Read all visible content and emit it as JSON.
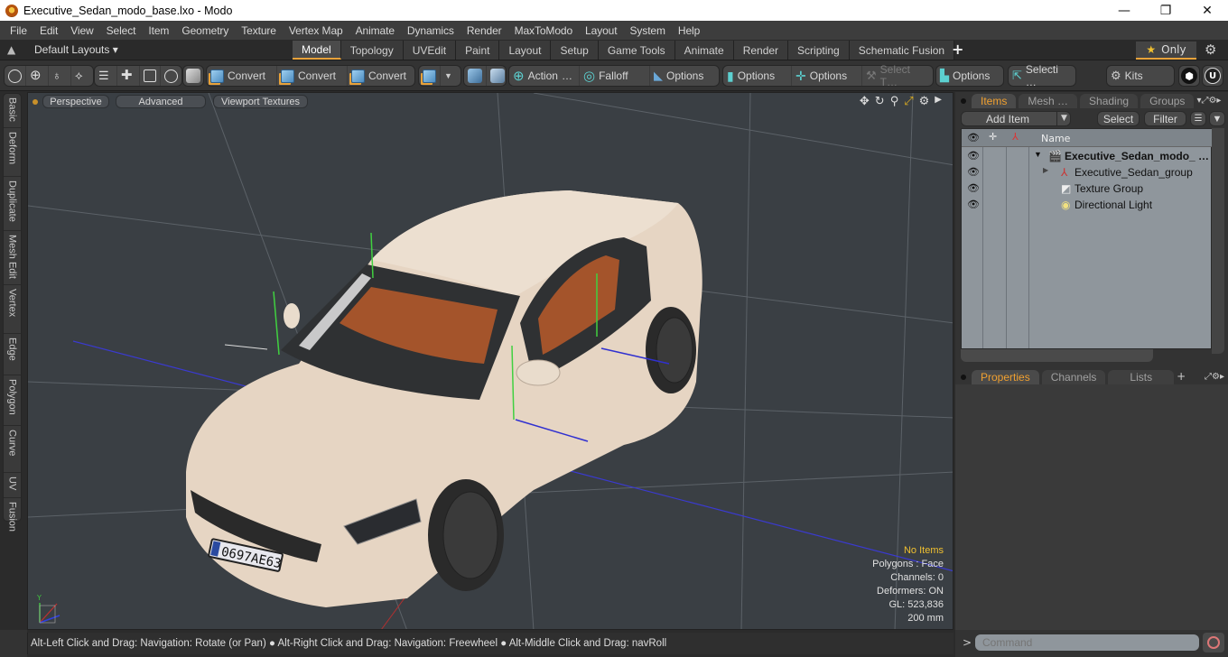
{
  "window": {
    "title": "Executive_Sedan_modo_base.lxo - Modo",
    "minimize_icon": "—",
    "maximize_icon": "❐",
    "close_icon": "✕"
  },
  "menu": [
    "File",
    "Edit",
    "View",
    "Select",
    "Item",
    "Geometry",
    "Texture",
    "Vertex Map",
    "Animate",
    "Dynamics",
    "Render",
    "MaxToModo",
    "Layout",
    "System",
    "Help"
  ],
  "layout_bar": {
    "default_layouts": "Default Layouts ▾",
    "tabs": [
      "Model",
      "Topology",
      "UVEdit",
      "Paint",
      "Layout",
      "Setup",
      "Game Tools",
      "Animate",
      "Render",
      "Scripting",
      "Schematic Fusion"
    ],
    "active_tab": "Model",
    "add_tab": "+",
    "only_label": "Only",
    "star": "★"
  },
  "toolbar": {
    "convert_labels": [
      "Convert",
      "Convert",
      "Convert"
    ],
    "action": "Action",
    "action_more": "…",
    "falloff": "Falloff",
    "options1": "Options",
    "options2": "Options",
    "options3": "Options",
    "select_t": "Select T…",
    "options4": "Options",
    "selecti": "Selecti …",
    "kits": "Kits"
  },
  "left_tabs": [
    "Basic",
    "Deform",
    "Duplicate",
    "Mesh Edit",
    "Vertex",
    "Edge",
    "Polygon",
    "Curve",
    "UV",
    "Fusion"
  ],
  "viewport": {
    "perspective": "Perspective",
    "advanced": "Advanced",
    "viewport_textures": "Viewport Textures",
    "info": {
      "selection": "No Items",
      "polygons": "Polygons : Face",
      "channels": "Channels: 0",
      "deformers": "Deformers: ON",
      "gl": "GL: 523,836",
      "scale": "200 mm"
    },
    "license_plate": "0697AE63",
    "axis_label": "Y"
  },
  "items_panel": {
    "tabs": [
      "Items",
      "Mesh …",
      "Shading",
      "Groups"
    ],
    "active_tab": "Items",
    "add_item": "Add Item",
    "select": "Select",
    "filter": "Filter",
    "name_header": "Name",
    "rows": [
      {
        "label": "Executive_Sedan_modo_ …",
        "icon": "scene-icon",
        "bold": true
      },
      {
        "label": "Executive_Sedan_group",
        "icon": "locator-icon",
        "bold": false
      },
      {
        "label": "Texture Group",
        "icon": "folder-icon",
        "bold": false
      },
      {
        "label": "Directional Light",
        "icon": "light-icon",
        "bold": false
      }
    ]
  },
  "properties_panel": {
    "tabs": [
      "Properties",
      "Channels",
      "Lists"
    ],
    "active_tab": "Properties",
    "add_tab": "+"
  },
  "status_bar": {
    "hint": "Alt-Left Click and Drag: Navigation: Rotate (or Pan) ● Alt-Right Click and Drag: Navigation: Freewheel ● Alt-Middle Click and Drag: navRoll"
  },
  "command": {
    "prompt": ">",
    "placeholder": "Command"
  },
  "colors": {
    "accent": "#e8a23a",
    "viewport_bg": "#3a3f44",
    "list_bg": "#8f969c",
    "car_body": "#e8d8c8",
    "interior": "#b85a2a"
  }
}
